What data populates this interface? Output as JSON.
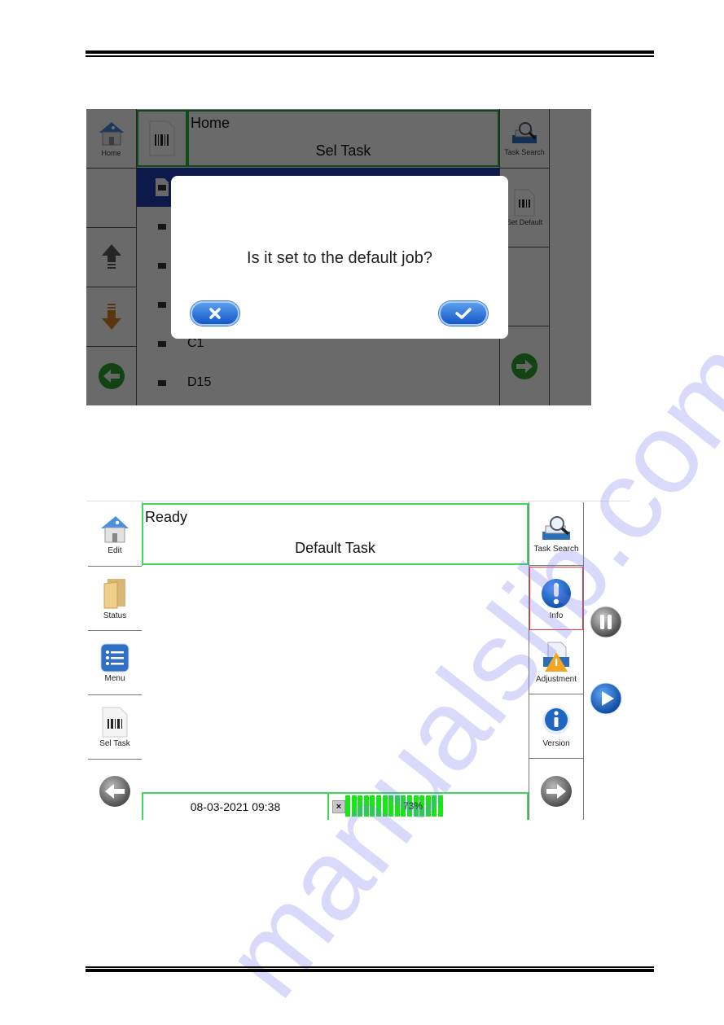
{
  "document": {
    "watermark": "manualslib.com"
  },
  "screen1": {
    "left_buttons": [
      {
        "label": "Home",
        "icon": "home-icon"
      },
      {
        "label": "",
        "icon": ""
      },
      {
        "label": "",
        "icon": "arrow-up-icon"
      },
      {
        "label": "",
        "icon": "arrow-down-icon"
      },
      {
        "label": "",
        "icon": "back-arrow-icon"
      }
    ],
    "header": {
      "icon": "barcode-file-icon",
      "title": "Home",
      "subtitle": "Sel Task"
    },
    "task_list": [
      {
        "name": "",
        "selected": true
      },
      {
        "name": "",
        "selected": false
      },
      {
        "name": "",
        "selected": false
      },
      {
        "name": "",
        "selected": false
      },
      {
        "name": "C1",
        "selected": false
      },
      {
        "name": "D15",
        "selected": false
      }
    ],
    "right_buttons": [
      {
        "label": "Task Search",
        "icon": "task-search-icon"
      },
      {
        "label": "Set Default",
        "icon": "barcode-file-icon"
      },
      {
        "label": "",
        "icon": ""
      },
      {
        "label": "",
        "icon": "forward-arrow-icon"
      }
    ],
    "dialog": {
      "question": "Is it set to the default job?",
      "cancel_icon": "close-icon",
      "confirm_icon": "check-icon"
    }
  },
  "screen2": {
    "left_buttons": [
      {
        "label": "Edit",
        "icon": "home-icon"
      },
      {
        "label": "Status",
        "icon": "folder-icon"
      },
      {
        "label": "Menu",
        "icon": "menu-list-icon"
      },
      {
        "label": "Sel Task",
        "icon": "barcode-file-icon"
      },
      {
        "label": "",
        "icon": "back-arrow-icon"
      }
    ],
    "header": {
      "status": "Ready",
      "task": "Default Task"
    },
    "status_bar": {
      "datetime": "08-03-2021 09:38",
      "clear_label": "×",
      "ink_level_percent": 73,
      "ink_level_text": "73%"
    },
    "right_buttons": [
      {
        "label": "Task Search",
        "icon": "task-search-icon",
        "highlighted": false
      },
      {
        "label": "Info",
        "icon": "alert-icon",
        "highlighted": true
      },
      {
        "label": "Adjustment",
        "icon": "adjustment-icon",
        "highlighted": false
      },
      {
        "label": "Version",
        "icon": "info-icon",
        "highlighted": false
      },
      {
        "label": "",
        "icon": "forward-arrow-icon",
        "highlighted": false
      }
    ],
    "side_controls": [
      {
        "name": "pause",
        "icon": "pause-icon"
      },
      {
        "name": "start",
        "icon": "play-icon"
      }
    ],
    "colors": {
      "frame_green": "#3fd95a",
      "ink_green": "#19e619",
      "highlight_red": "#ee3333",
      "selection_blue": "#1e3aa8"
    }
  }
}
